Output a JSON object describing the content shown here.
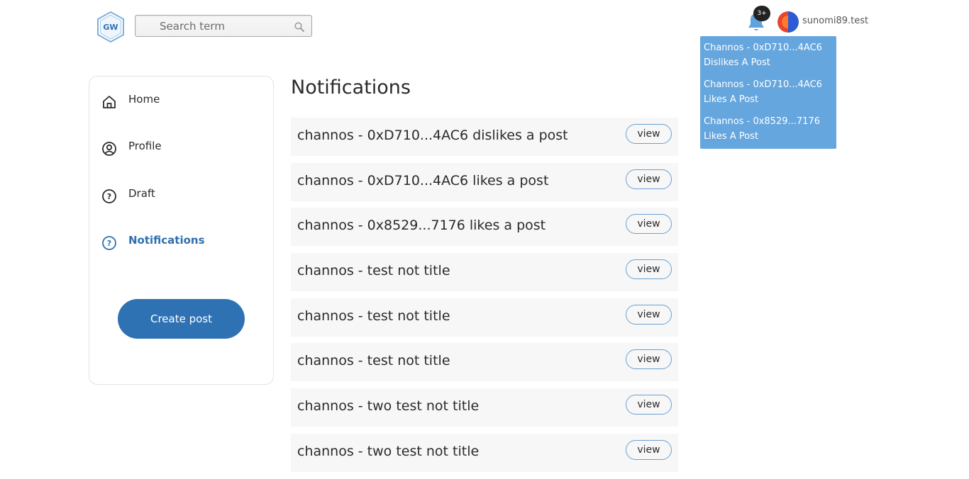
{
  "header": {
    "search": {
      "placeholder": "Search term",
      "value": ""
    },
    "notifications_badge": "3+",
    "username": "sunomi89.test",
    "colors": {
      "accent": "#2f72b3",
      "dropdown_bg": "#66a6de",
      "bell": "#5fa3dc"
    }
  },
  "dropdown": {
    "items": [
      {
        "line1": "Channos - 0xD710...4AC6",
        "line2": "Dislikes A Post"
      },
      {
        "line1": "Channos - 0xD710...4AC6",
        "line2": "Likes A Post"
      },
      {
        "line1": "Channos - 0x8529...7176",
        "line2": "Likes A Post"
      }
    ]
  },
  "sidebar": {
    "items": [
      {
        "label": "Home",
        "icon": "home-icon"
      },
      {
        "label": "Profile",
        "icon": "user-circle-icon"
      },
      {
        "label": "Draft",
        "icon": "question-circle-icon"
      },
      {
        "label": "Notifications",
        "icon": "question-circle-icon",
        "active": true
      }
    ],
    "create_post_label": "Create post"
  },
  "main": {
    "title": "Notifications",
    "view_label": "view",
    "notifications": [
      {
        "text": "channos - 0xD710...4AC6 dislikes a post"
      },
      {
        "text": "channos - 0xD710...4AC6 likes a post"
      },
      {
        "text": "channos - 0x8529...7176 likes a post"
      },
      {
        "text": "channos - test not title"
      },
      {
        "text": "channos - test not title"
      },
      {
        "text": "channos - test not title"
      },
      {
        "text": "channos - two test not title"
      },
      {
        "text": "channos - two test not title"
      }
    ]
  }
}
